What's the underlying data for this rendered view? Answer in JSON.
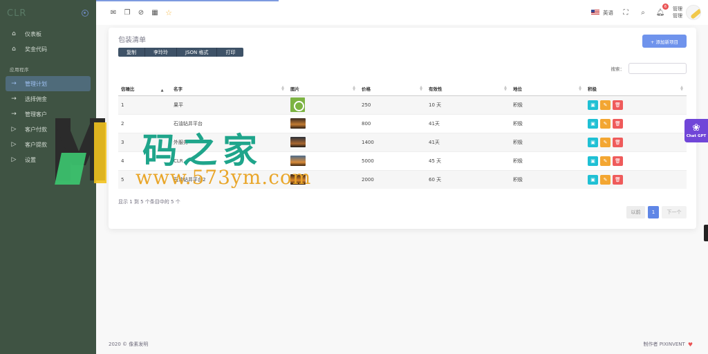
{
  "sidebar": {
    "logo": "CLR",
    "items": [
      {
        "label": "仪表板",
        "icon": "home-icon"
      },
      {
        "label": "奖金代码",
        "icon": "home-icon"
      }
    ],
    "section": "应用程序",
    "app_items": [
      {
        "label": "管理计划",
        "icon": "arrow-right-icon",
        "active": true
      },
      {
        "label": "选择佣金",
        "icon": "arrow-right-icon"
      },
      {
        "label": "管理客户",
        "icon": "arrow-right-icon"
      },
      {
        "label": "客户付款",
        "icon": "play-icon"
      },
      {
        "label": "客户提款",
        "icon": "play-icon"
      },
      {
        "label": "设置",
        "icon": "play-icon"
      }
    ]
  },
  "navbar": {
    "icons": [
      "mail-icon",
      "chat-icon",
      "check-circle-icon",
      "calendar-icon",
      "star-icon"
    ],
    "language": "英语",
    "notifications": "6",
    "user_name": "管理",
    "user_role": "管理"
  },
  "card": {
    "title": "包装清单",
    "export_buttons": [
      "复制",
      "李玲玲",
      "JSON 格式",
      "打印"
    ],
    "add_button": "+ 添加新项目",
    "search_label": "搜索：",
    "search_value": ""
  },
  "table": {
    "columns": [
      "信噪比",
      "名字",
      "图片",
      "价格",
      "有效性",
      "地位",
      "积极"
    ],
    "rows": [
      {
        "no": "1",
        "name": "果平",
        "price": "250",
        "validity": "10 天",
        "status": "积极"
      },
      {
        "no": "2",
        "name": "石油钻井平台",
        "price": "800",
        "validity": "41天",
        "status": "积极"
      },
      {
        "no": "3",
        "name": "外服务",
        "price": "1400",
        "validity": "41天",
        "status": "积极"
      },
      {
        "no": "4",
        "name": "CLR",
        "price": "5000",
        "validity": "45 天",
        "status": "积极"
      },
      {
        "no": "5",
        "name": "石油钻井平台2",
        "price": "2000",
        "validity": "60 天",
        "status": "积极"
      }
    ]
  },
  "info_text": "显示 1 到 5 个条目中的 5 个",
  "pagination": {
    "prev": "以前",
    "current": "1",
    "next": "下一个"
  },
  "footer": {
    "left": "2020 © 像素发明",
    "right": "制作者 PIXINVENT"
  },
  "chatgpt": {
    "label": "Chat GPT"
  },
  "watermark": {
    "title": "码之家",
    "url": "www.573ym.com"
  },
  "colors": {
    "sidebar": "#3f5343",
    "accent": "#6f93ec",
    "view": "#1fc0d4",
    "edit": "#f3a632",
    "delete": "#ef5b5b"
  }
}
